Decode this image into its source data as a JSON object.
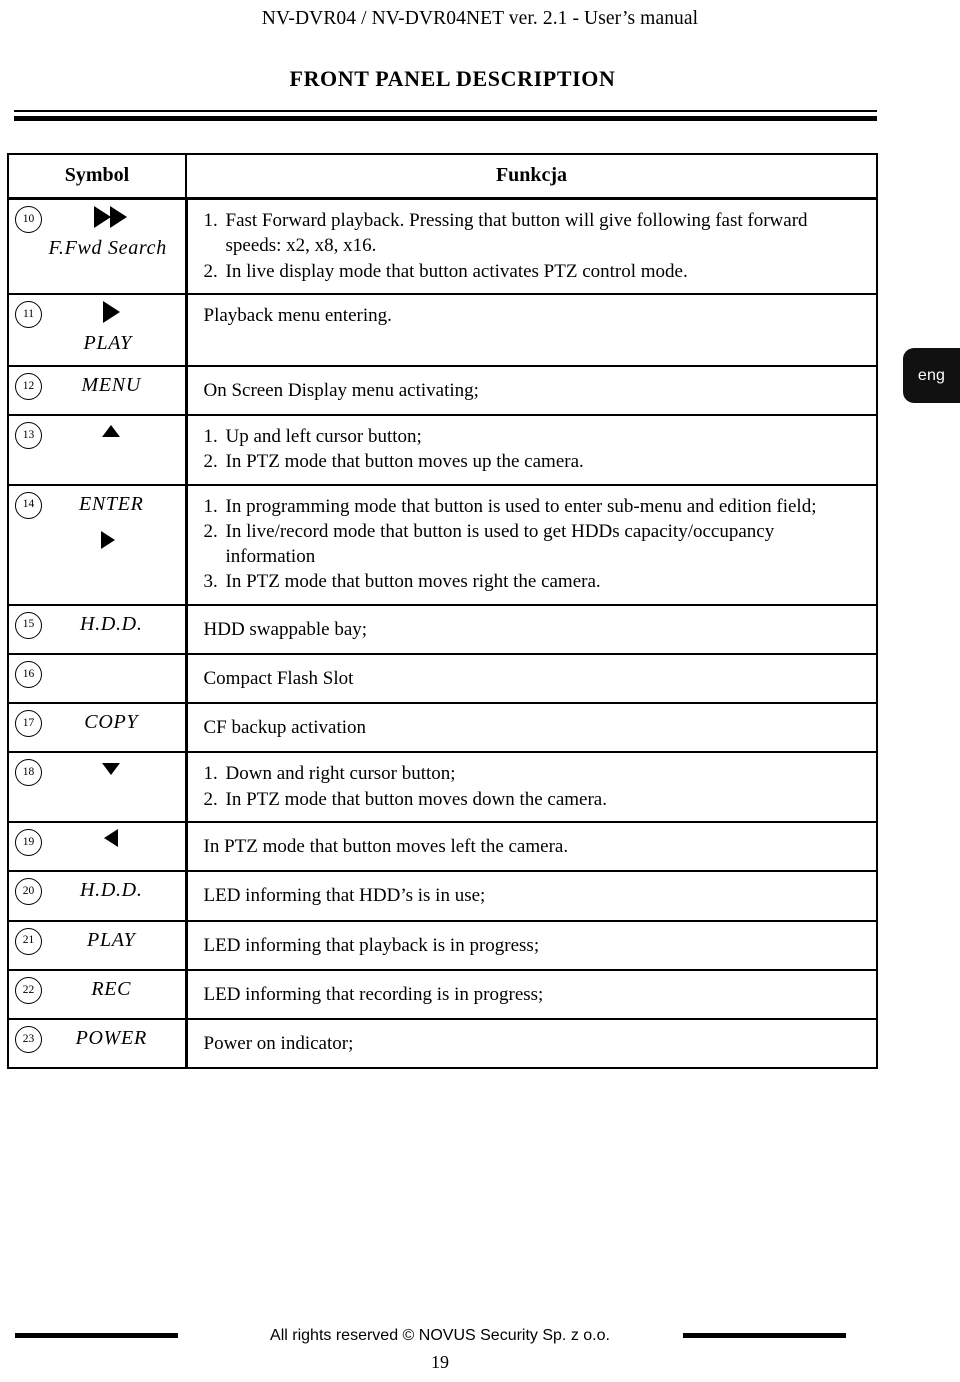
{
  "header": {
    "running_title": "NV-DVR04 / NV-DVR04NET ver. 2.1 - User’s manual",
    "section_title": "FRONT PANEL DESCRIPTION"
  },
  "language_tab": {
    "label": "eng",
    "background_color": "#111111",
    "text_color": "#ffffff"
  },
  "table": {
    "columns": {
      "symbol": "Symbol",
      "function": "Funkcja"
    },
    "rows": [
      {
        "number": "10",
        "symbol_icon": "fast-forward-icon",
        "symbol_label": "F.Fwd Search",
        "items": [
          {
            "n": "1.",
            "t": "Fast Forward playback. Pressing that button will give following fast forward speeds: x2, x8, x16."
          },
          {
            "n": "2.",
            "t": "In live display mode that button activates PTZ control mode."
          }
        ]
      },
      {
        "number": "11",
        "symbol_icon": "play-triangle-icon",
        "symbol_label": "PLAY",
        "text": "Playback menu entering."
      },
      {
        "number": "12",
        "symbol_icon": null,
        "symbol_label": "MENU",
        "text": "On Screen Display menu activating;"
      },
      {
        "number": "13",
        "symbol_icon": "cursor-up-icon",
        "symbol_label": null,
        "items": [
          {
            "n": "1.",
            "t": "Up and left cursor button;"
          },
          {
            "n": "2.",
            "t": "In PTZ mode that button moves up the camera."
          }
        ]
      },
      {
        "number": "14",
        "symbol_icon": "cursor-right-icon",
        "symbol_label": "ENTER",
        "items": [
          {
            "n": "1.",
            "t": "In programming mode that button is used to enter sub-menu and edition field;"
          },
          {
            "n": "2.",
            "t": "In live/record mode that button is used to get HDDs capacity/occupancy information"
          },
          {
            "n": "3.",
            "t": "In PTZ mode that button moves right the camera."
          }
        ]
      },
      {
        "number": "15",
        "symbol_icon": null,
        "symbol_label": "H.D.D.",
        "text": "HDD swappable bay;"
      },
      {
        "number": "16",
        "symbol_icon": null,
        "symbol_label": null,
        "text": "Compact Flash Slot"
      },
      {
        "number": "17",
        "symbol_icon": null,
        "symbol_label": "COPY",
        "text": "CF backup activation"
      },
      {
        "number": "18",
        "symbol_icon": "cursor-down-icon",
        "symbol_label": null,
        "items": [
          {
            "n": "1.",
            "t": "Down and right cursor button;"
          },
          {
            "n": "2.",
            "t": "In PTZ mode that button moves down the camera."
          }
        ]
      },
      {
        "number": "19",
        "symbol_icon": "cursor-left-icon",
        "symbol_label": null,
        "text": "In PTZ mode that button moves left the camera."
      },
      {
        "number": "20",
        "symbol_icon": null,
        "symbol_label": "H.D.D.",
        "text": "LED informing that HDD’s is in use;"
      },
      {
        "number": "21",
        "symbol_icon": null,
        "symbol_label": "PLAY",
        "text": "LED informing that playback is in progress;"
      },
      {
        "number": "22",
        "symbol_icon": null,
        "symbol_label": "REC",
        "text": "LED informing that recording is in progress;"
      },
      {
        "number": "23",
        "symbol_icon": null,
        "symbol_label": "POWER",
        "text": "Power on indicator;"
      }
    ]
  },
  "footer": {
    "copyright": "All rights reserved © NOVUS Security Sp. z o.o.",
    "page_number": "19"
  }
}
